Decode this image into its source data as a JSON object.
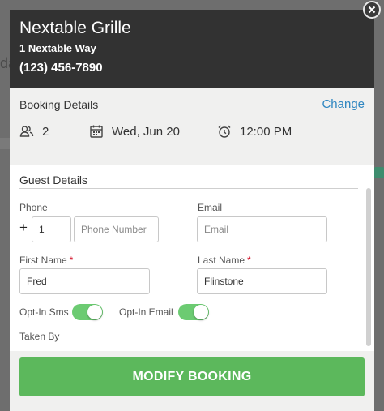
{
  "restaurant": {
    "name": "Nextable Grille",
    "address": "1 Nextable Way",
    "phone": "(123) 456-7890"
  },
  "booking_details": {
    "title": "Booking Details",
    "change_label": "Change",
    "guests": "2",
    "date": "Wed, Jun 20",
    "time": "12:00 PM"
  },
  "guest_details": {
    "title": "Guest Details",
    "phone_label": "Phone",
    "plus_sign": "+",
    "country_code": "1",
    "phone_placeholder": "Phone Number",
    "email_label": "Email",
    "email_placeholder": "Email",
    "first_name_label": "First Name",
    "first_name_value": "Fred",
    "last_name_label": "Last Name",
    "last_name_value": "Flinstone",
    "required_marker": "*",
    "opt_in_sms_label": "Opt-In Sms",
    "opt_in_sms": true,
    "opt_in_email_label": "Opt-In Email",
    "opt_in_email": true,
    "taken_by_label": "Taken By"
  },
  "footer": {
    "modify_label": "MODIFY BOOKING"
  },
  "colors": {
    "header_bg": "#323232",
    "accent_green": "#5cb85c",
    "link_blue": "#2e86c1",
    "required_red": "#d0021b"
  }
}
